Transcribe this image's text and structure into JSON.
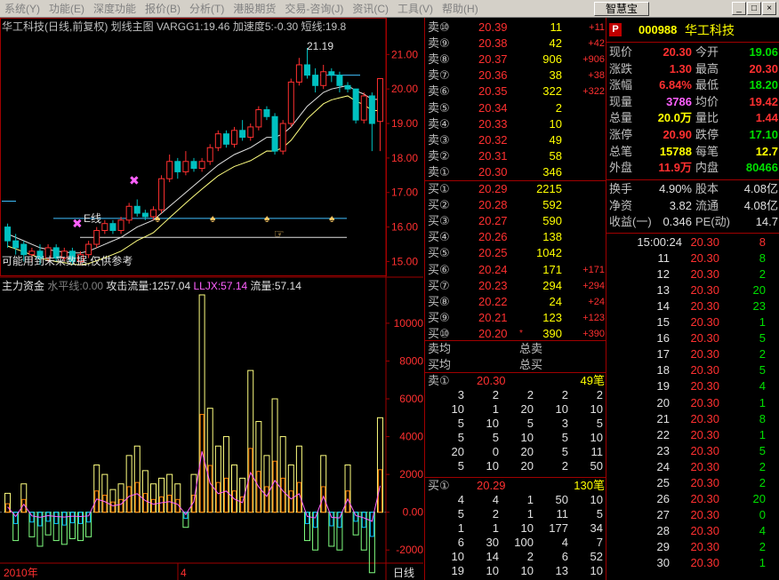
{
  "menu": [
    "系统(Y)",
    "功能(E)",
    "深度功能",
    "报价(B)",
    "分析(T)",
    "港股期货",
    "交易-咨询(J)",
    "资讯(C)",
    "工具(V)",
    "帮助(H)"
  ],
  "toolbar": {
    "app_button": "智慧宝",
    "min": "_",
    "restore": "□",
    "close": "×"
  },
  "chart": {
    "title": "华工科技(日线,前复权) 划线主图 VARGG1:19.46 加速度5:-0.30 短线:19.8",
    "price_ticks": [
      "21.00",
      "20.00",
      "19.00",
      "18.00",
      "17.00",
      "16.00",
      "15.00"
    ],
    "price_tick_vals": [
      21,
      20,
      19,
      18,
      17,
      16,
      15
    ],
    "high_label": "21.19",
    "e_label": "E线",
    "note": "可能用到未来数据,仅供参考",
    "vol_title": {
      "a": "主力资金",
      "b": "水平线:0.00",
      "c": "攻击流量:1257.04",
      "d": "LLJX:57.14",
      "e": "流量:57.14"
    },
    "vol_ticks": [
      "10000",
      "8000",
      "6000",
      "4000",
      "2000",
      "0.00",
      "-2000"
    ],
    "vol_tick_vals": [
      10000,
      8000,
      6000,
      4000,
      2000,
      0,
      -2000
    ],
    "date_left": "2010年",
    "date_mid": "4",
    "period": "日线",
    "colors": {
      "up": "#ff3030",
      "down": "#00c0c0",
      "bar_pos": "#ffff80",
      "bar_neg": "#00c0ff"
    }
  },
  "chart_data": {
    "type": "candlestick",
    "candles": [
      [
        16.0,
        15.6,
        16.1,
        15.4
      ],
      [
        15.6,
        15.4,
        15.8,
        15.2
      ],
      [
        15.5,
        15.2,
        15.6,
        15.0
      ],
      [
        15.2,
        15.3,
        15.4,
        15.0
      ],
      [
        15.3,
        15.1,
        15.5,
        14.9
      ],
      [
        15.1,
        15.4,
        15.5,
        15.0
      ],
      [
        15.4,
        15.1,
        15.5,
        15.0
      ],
      [
        15.1,
        15.3,
        15.4,
        15.0
      ],
      [
        15.3,
        15.0,
        15.4,
        14.9
      ],
      [
        15.0,
        15.2,
        15.3,
        14.9
      ],
      [
        15.2,
        15.5,
        15.6,
        15.1
      ],
      [
        15.5,
        15.9,
        16.0,
        15.4
      ],
      [
        15.9,
        16.1,
        16.2,
        15.8
      ],
      [
        16.1,
        15.9,
        16.2,
        15.8
      ],
      [
        15.9,
        16.2,
        16.3,
        15.8
      ],
      [
        16.2,
        16.6,
        16.7,
        16.1
      ],
      [
        16.6,
        16.4,
        16.8,
        16.3
      ],
      [
        16.4,
        16.3,
        16.5,
        16.2
      ],
      [
        16.3,
        16.5,
        16.6,
        16.2
      ],
      [
        16.5,
        17.4,
        17.5,
        16.4
      ],
      [
        17.4,
        17.9,
        18.1,
        17.3
      ],
      [
        17.9,
        17.6,
        18.0,
        17.4
      ],
      [
        17.6,
        17.9,
        18.2,
        17.5
      ],
      [
        17.9,
        17.7,
        18.0,
        17.6
      ],
      [
        17.7,
        17.9,
        18.0,
        17.6
      ],
      [
        17.9,
        18.3,
        18.4,
        17.8
      ],
      [
        18.3,
        18.7,
        18.8,
        18.2
      ],
      [
        18.7,
        18.4,
        18.8,
        18.3
      ],
      [
        18.4,
        18.8,
        18.9,
        18.3
      ],
      [
        18.8,
        18.6,
        19.1,
        18.5
      ],
      [
        18.6,
        18.9,
        19.0,
        18.5
      ],
      [
        18.9,
        19.4,
        19.5,
        18.8
      ],
      [
        19.4,
        19.2,
        19.5,
        19.1
      ],
      [
        19.2,
        18.2,
        19.3,
        18.1
      ],
      [
        18.2,
        19.0,
        19.1,
        18.1
      ],
      [
        19.0,
        20.2,
        20.3,
        18.9
      ],
      [
        20.2,
        20.7,
        20.9,
        20.1
      ],
      [
        20.7,
        20.4,
        21.19,
        20.3
      ],
      [
        20.4,
        20.1,
        20.6,
        19.9
      ],
      [
        20.1,
        20.5,
        20.7,
        20.0
      ],
      [
        20.5,
        20.4,
        20.6,
        20.2
      ],
      [
        20.4,
        20.1,
        20.5,
        19.9
      ],
      [
        20.1,
        20.0,
        20.2,
        19.9
      ],
      [
        20.0,
        19.1,
        20.0,
        19.0
      ],
      [
        19.1,
        19.8,
        19.9,
        19.0
      ],
      [
        19.8,
        19.0,
        19.9,
        18.2
      ],
      [
        19.06,
        20.3,
        20.3,
        18.2
      ]
    ],
    "ma": [
      15.8,
      15.7,
      15.6,
      15.5,
      15.4,
      15.35,
      15.3,
      15.28,
      15.25,
      15.25,
      15.3,
      15.4,
      15.5,
      15.6,
      15.7,
      15.85,
      16.0,
      16.1,
      16.2,
      16.4,
      16.6,
      16.8,
      17.0,
      17.2,
      17.4,
      17.6,
      17.8,
      17.95,
      18.1,
      18.2,
      18.3,
      18.45,
      18.6,
      18.6,
      18.7,
      18.9,
      19.2,
      19.5,
      19.7,
      19.9,
      20.0,
      20.05,
      20.1,
      19.95,
      19.85,
      19.7,
      19.7
    ],
    "vol_bars": [
      1000,
      -1500,
      1500,
      -1300,
      -1800,
      -1200,
      -1500,
      -1700,
      -1400,
      -1500,
      -1300,
      2500,
      2000,
      1200,
      1500,
      3000,
      3500,
      2200,
      1500,
      1800,
      2000,
      1500,
      -800,
      2000,
      11500,
      5500,
      3500,
      4000,
      2500,
      1800,
      7500,
      4800,
      3000,
      6000,
      4000,
      2500,
      3500,
      -1500,
      -2000,
      3000,
      -1800,
      -2000,
      2500,
      -1200,
      -2000,
      -3200,
      5000
    ],
    "xlabel": "",
    "ylabel": "",
    "ylim": [
      14.6,
      21.6
    ],
    "vol_ylim": [
      -2600,
      11500
    ]
  },
  "code": {
    "badge": "P",
    "number": "000988",
    "name": "华工科技"
  },
  "sell_orders": [
    {
      "label": "卖⑩",
      "price": "20.39",
      "vol": "11",
      "chg": "+11"
    },
    {
      "label": "卖⑨",
      "price": "20.38",
      "vol": "42",
      "chg": "+42"
    },
    {
      "label": "卖⑧",
      "price": "20.37",
      "vol": "906",
      "chg": "+906"
    },
    {
      "label": "卖⑦",
      "price": "20.36",
      "vol": "38",
      "chg": "+38"
    },
    {
      "label": "卖⑥",
      "price": "20.35",
      "vol": "322",
      "chg": "+322"
    },
    {
      "label": "卖⑤",
      "price": "20.34",
      "vol": "2",
      "chg": ""
    },
    {
      "label": "卖④",
      "price": "20.33",
      "vol": "10",
      "chg": ""
    },
    {
      "label": "卖③",
      "price": "20.32",
      "vol": "49",
      "chg": ""
    },
    {
      "label": "卖②",
      "price": "20.31",
      "vol": "58",
      "chg": ""
    },
    {
      "label": "卖①",
      "price": "20.30",
      "vol": "346",
      "chg": ""
    }
  ],
  "buy_orders": [
    {
      "label": "买①",
      "price": "20.29",
      "vol": "2215",
      "chg": ""
    },
    {
      "label": "买②",
      "price": "20.28",
      "vol": "592",
      "chg": ""
    },
    {
      "label": "买③",
      "price": "20.27",
      "vol": "590",
      "chg": ""
    },
    {
      "label": "买④",
      "price": "20.26",
      "vol": "138",
      "chg": ""
    },
    {
      "label": "买⑤",
      "price": "20.25",
      "vol": "1042",
      "chg": ""
    },
    {
      "label": "买⑥",
      "price": "20.24",
      "vol": "171",
      "chg": "+171"
    },
    {
      "label": "买⑦",
      "price": "20.23",
      "vol": "294",
      "chg": "+294"
    },
    {
      "label": "买⑧",
      "price": "20.22",
      "vol": "24",
      "chg": "+24"
    },
    {
      "label": "买⑨",
      "price": "20.21",
      "vol": "123",
      "chg": "+123"
    },
    {
      "label": "买⑩",
      "price": "20.20",
      "vol": "390",
      "chg": "+390",
      "mark": "*"
    }
  ],
  "avg": {
    "sell_avg": "卖均",
    "buy_avg": "买均",
    "total_sell": "总卖",
    "total_buy": "总买"
  },
  "queue_sell": {
    "label": "卖①",
    "price": "20.30",
    "count": "49笔",
    "rows": [
      [
        "3",
        "2",
        "2",
        "2",
        "2"
      ],
      [
        "10",
        "1",
        "20",
        "10",
        "10"
      ],
      [
        "5",
        "10",
        "5",
        "3",
        "5"
      ],
      [
        "5",
        "5",
        "10",
        "5",
        "10"
      ],
      [
        "20",
        "0",
        "20",
        "5",
        "11"
      ],
      [
        "5",
        "10",
        "20",
        "2",
        "50"
      ]
    ]
  },
  "queue_buy": {
    "label": "买①",
    "price": "20.29",
    "count": "130笔",
    "rows": [
      [
        "4",
        "4",
        "1",
        "50",
        "10"
      ],
      [
        "5",
        "2",
        "1",
        "11",
        "5"
      ],
      [
        "1",
        "1",
        "10",
        "177",
        "34"
      ],
      [
        "6",
        "30",
        "100",
        "4",
        "7"
      ],
      [
        "10",
        "14",
        "2",
        "6",
        "52"
      ],
      [
        "19",
        "10",
        "10",
        "13",
        "10"
      ]
    ]
  },
  "quote": [
    [
      {
        "l": "现价",
        "v": "20.30",
        "c": "red"
      },
      {
        "l": "今开",
        "v": "19.06",
        "c": "grn"
      }
    ],
    [
      {
        "l": "涨跌",
        "v": "1.30",
        "c": "red"
      },
      {
        "l": "最高",
        "v": "20.30",
        "c": "red"
      }
    ],
    [
      {
        "l": "涨幅",
        "v": "6.84%",
        "c": "red"
      },
      {
        "l": "最低",
        "v": "18.20",
        "c": "grn"
      }
    ],
    [
      {
        "l": "现量",
        "v": "3786",
        "c": "mag"
      },
      {
        "l": "均价",
        "v": "19.42",
        "c": "red"
      }
    ],
    [
      {
        "l": "总量",
        "v": "20.0万",
        "c": "yel"
      },
      {
        "l": "量比",
        "v": "1.44",
        "c": "red"
      }
    ],
    [
      {
        "l": "涨停",
        "v": "20.90",
        "c": "red"
      },
      {
        "l": "跌停",
        "v": "17.10",
        "c": "grn"
      }
    ],
    [
      {
        "l": "总笔",
        "v": "15788",
        "c": "yel"
      },
      {
        "l": "每笔",
        "v": "12.7",
        "c": "yel"
      }
    ],
    [
      {
        "l": "外盘",
        "v": "11.9万",
        "c": "red"
      },
      {
        "l": "内盘",
        "v": "80466",
        "c": "grn"
      }
    ]
  ],
  "fund": [
    [
      {
        "l": "换手",
        "v": "4.90%"
      },
      {
        "l": "股本",
        "v": "4.08亿"
      }
    ],
    [
      {
        "l": "净资",
        "v": "3.82"
      },
      {
        "l": "流通",
        "v": "4.08亿"
      }
    ],
    [
      {
        "l": "收益(一)",
        "v": "0.346"
      },
      {
        "l": "PE(动)",
        "v": "14.7"
      }
    ]
  ],
  "ticks": [
    [
      "15:00:24",
      "20.30",
      "8",
      "red"
    ],
    [
      "11",
      "20.30",
      "8",
      "grn"
    ],
    [
      "12",
      "20.30",
      "2",
      "grn"
    ],
    [
      "13",
      "20.30",
      "20",
      "grn"
    ],
    [
      "14",
      "20.30",
      "23",
      "grn"
    ],
    [
      "15",
      "20.30",
      "1",
      "grn"
    ],
    [
      "16",
      "20.30",
      "5",
      "grn"
    ],
    [
      "17",
      "20.30",
      "2",
      "grn"
    ],
    [
      "18",
      "20.30",
      "5",
      "grn"
    ],
    [
      "19",
      "20.30",
      "4",
      "grn"
    ],
    [
      "20",
      "20.30",
      "1",
      "grn"
    ],
    [
      "21",
      "20.30",
      "8",
      "grn"
    ],
    [
      "22",
      "20.30",
      "1",
      "grn"
    ],
    [
      "23",
      "20.30",
      "5",
      "grn"
    ],
    [
      "24",
      "20.30",
      "2",
      "grn"
    ],
    [
      "25",
      "20.30",
      "2",
      "grn"
    ],
    [
      "26",
      "20.30",
      "20",
      "grn"
    ],
    [
      "27",
      "20.30",
      "0",
      "grn"
    ],
    [
      "28",
      "20.30",
      "4",
      "grn"
    ],
    [
      "29",
      "20.30",
      "2",
      "grn"
    ],
    [
      "30",
      "20.30",
      "1",
      "grn"
    ]
  ]
}
